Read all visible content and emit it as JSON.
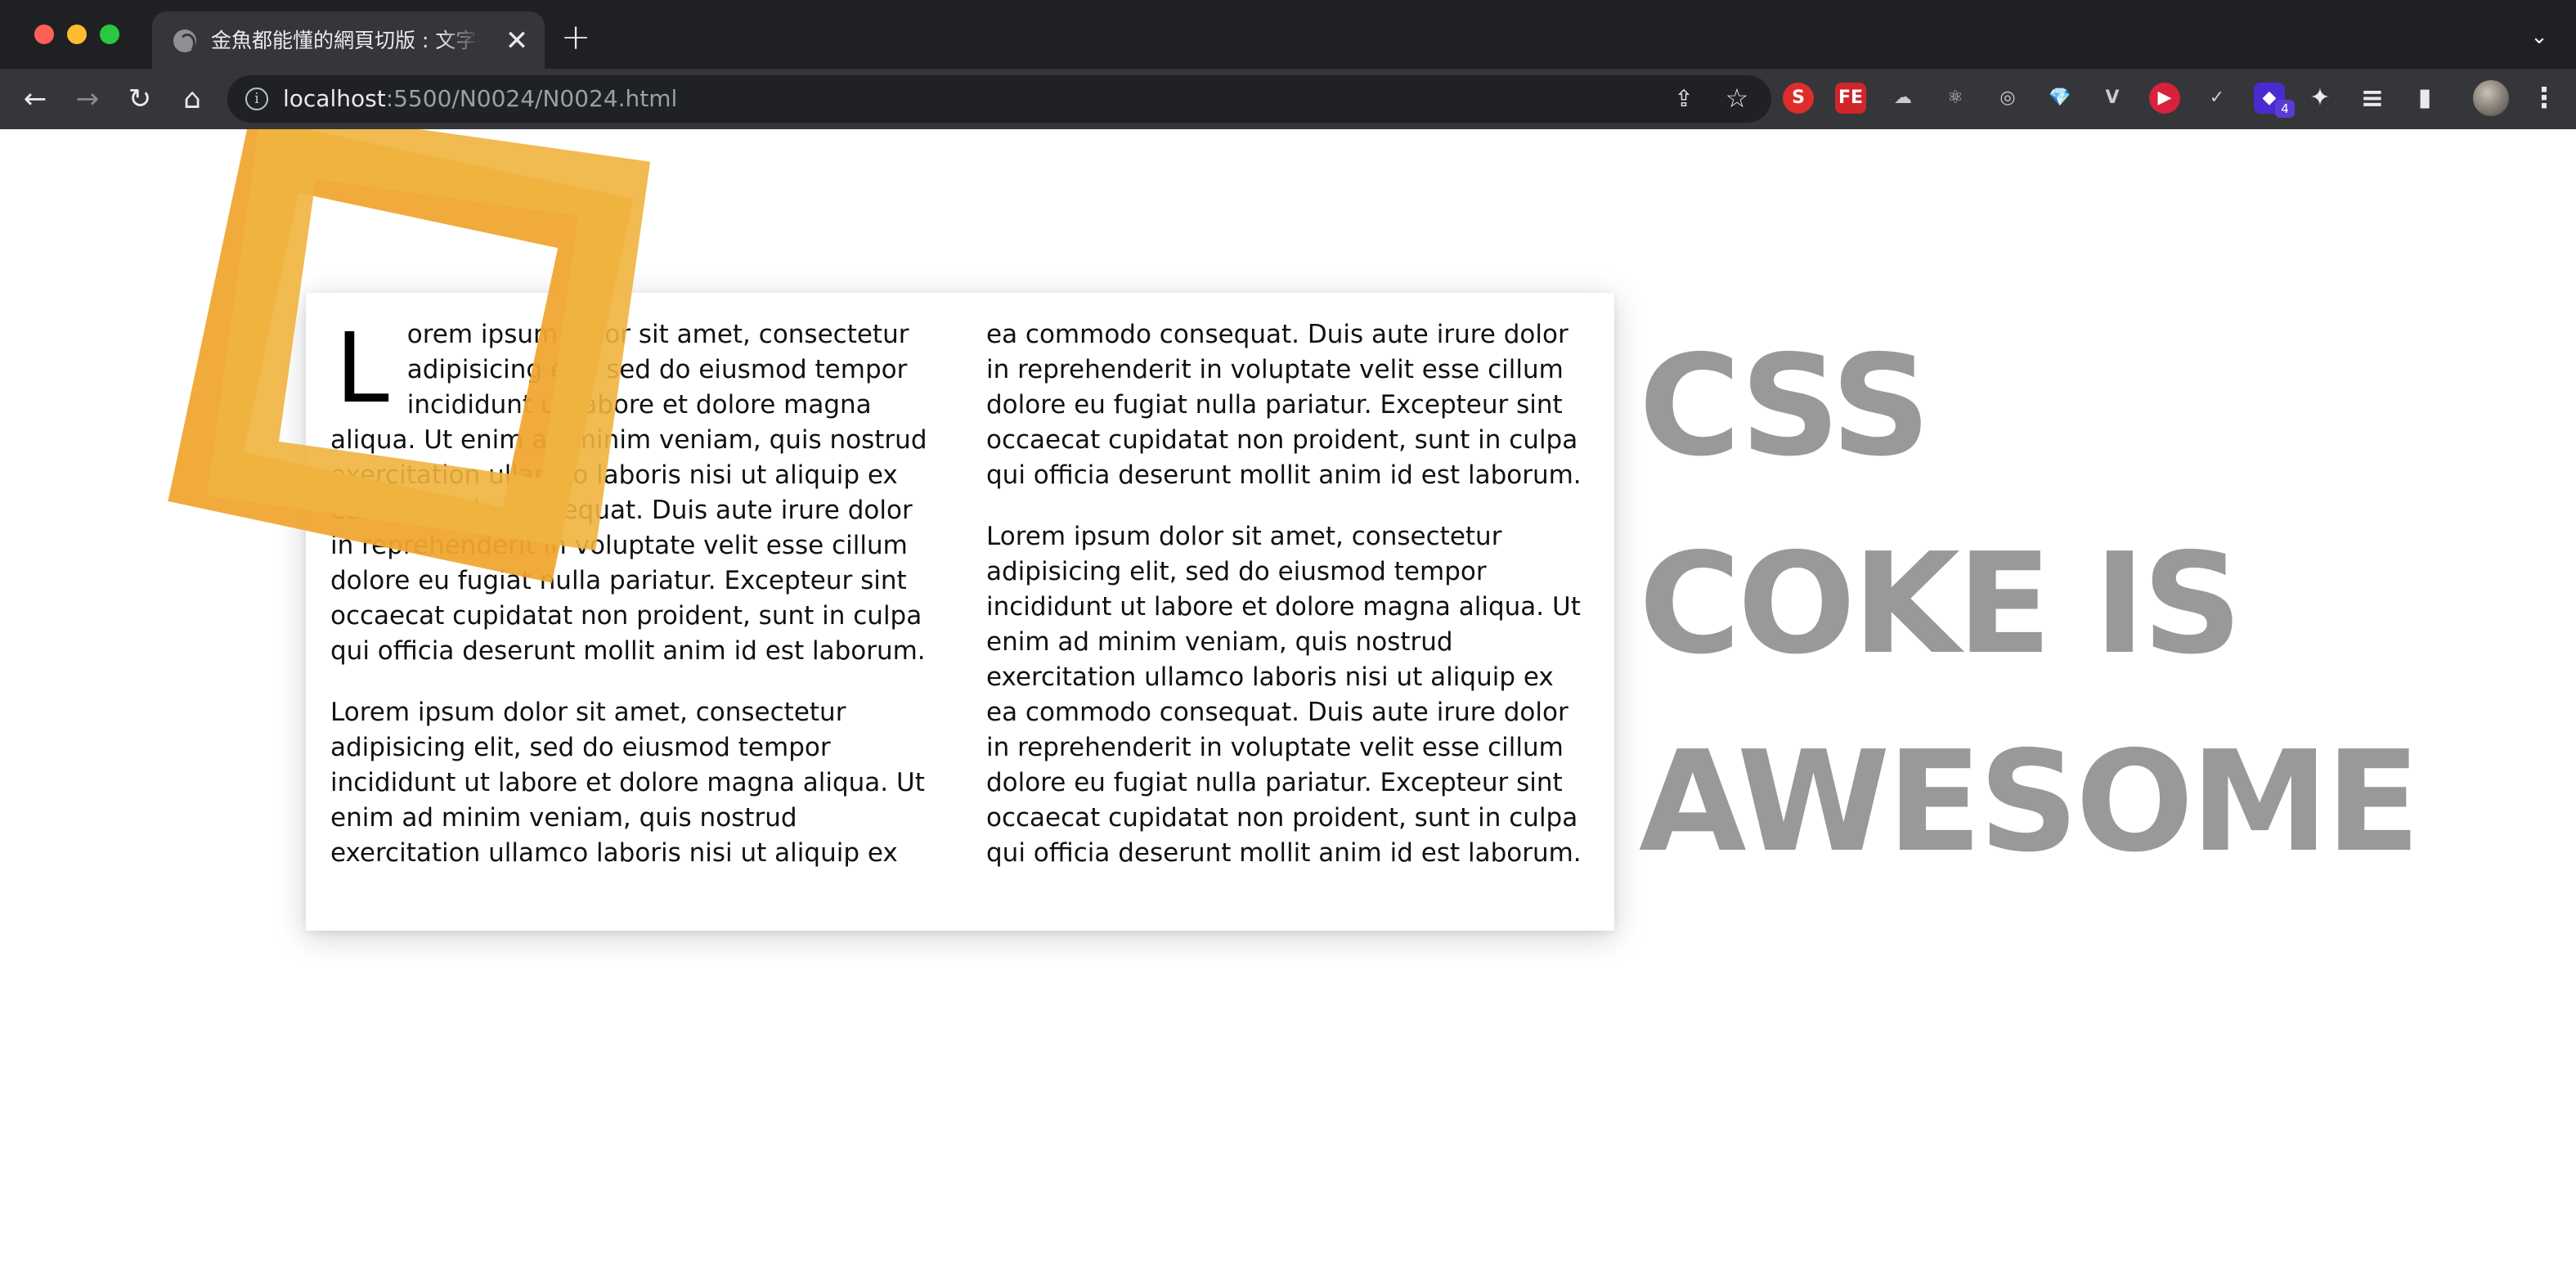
{
  "browser": {
    "tab_title": "金魚都能懂的網頁切版 : 文字排版",
    "tab_close": "✕",
    "new_tab": "+",
    "tab_menu": "⌄",
    "url_host": "localhost",
    "url_path": ":5500/N0024/N0024.html",
    "nav": {
      "back": "←",
      "forward": "→",
      "reload": "↻",
      "home": "⌂"
    },
    "extensions": [
      {
        "name": "s-extension-icon",
        "label": "S",
        "color": "#e02c2c"
      },
      {
        "name": "fe-extension-icon",
        "label": "FE",
        "color": "#d0262a"
      },
      {
        "name": "cloud-extension-icon",
        "label": "☁",
        "color": "transparent"
      },
      {
        "name": "react-extension-icon",
        "label": "⚛",
        "color": "transparent"
      },
      {
        "name": "target-extension-icon",
        "label": "◎",
        "color": "transparent"
      },
      {
        "name": "gem-extension-icon",
        "label": "💎",
        "color": "transparent"
      },
      {
        "name": "vue-extension-icon",
        "label": "V",
        "color": "transparent"
      },
      {
        "name": "play-extension-icon",
        "label": "▶",
        "color": "#d8213c"
      },
      {
        "name": "check-extension-icon",
        "label": "✓",
        "color": "transparent"
      },
      {
        "name": "layers-extension-icon",
        "label": "◆",
        "color": "#4a2bd0"
      }
    ],
    "extension_badge": "4",
    "puzzle_icon": "✦",
    "reading_list_icon": "≡",
    "sidepanel_icon": "▮",
    "menu_icon": "⋮"
  },
  "article": {
    "dropcap": "L",
    "paragraphs": [
      "orem ipsum dolor sit amet, consectetur adipisicing elit, sed do eiusmod tempor incididunt ut labore et dolore magna aliqua. Ut enim ad minim veniam, quis nostrud exercitation ullamco laboris nisi ut aliquip ex ea commodo consequat. Duis aute irure dolor in reprehenderit in voluptate velit esse cillum dolore eu fugiat nulla pariatur. Excepteur sint occaecat cupidatat non proident, sunt in culpa qui officia deserunt mollit anim id est laborum.",
      "Lorem ipsum dolor sit amet, consectetur adipisicing elit, sed do eiusmod tempor incididunt ut labore et dolore magna aliqua. Ut enim ad minim veniam, quis nostrud exercitation ullamco laboris nisi ut aliquip ex ea commodo consequat. Duis aute irure dolor in reprehenderit in voluptate velit esse cillum dolore eu fugiat nulla pariatur. Excepteur sint occaecat cupidatat non proident, sunt in culpa qui officia deserunt mollit anim id est laborum.",
      "Lorem ipsum dolor sit amet, consectetur adipisicing elit, sed do eiusmod tempor incididunt ut labore et dolore magna aliqua. Ut enim ad minim veniam, quis nostrud exercitation ullamco laboris nisi ut aliquip ex ea commodo consequat. Duis aute irure dolor in reprehenderit in voluptate velit esse cillum dolore eu fugiat nulla pariatur. Excepteur sint occaecat cupidatat non proident, sunt in culpa qui officia deserunt mollit anim id est laborum."
    ]
  },
  "headline": {
    "line1": "CSS",
    "line2": "COKE IS",
    "line3": "AWESOME"
  },
  "colors": {
    "headline": "#999999",
    "deco_orange": "#f0a733",
    "deco_yellow": "#f0b43e"
  }
}
